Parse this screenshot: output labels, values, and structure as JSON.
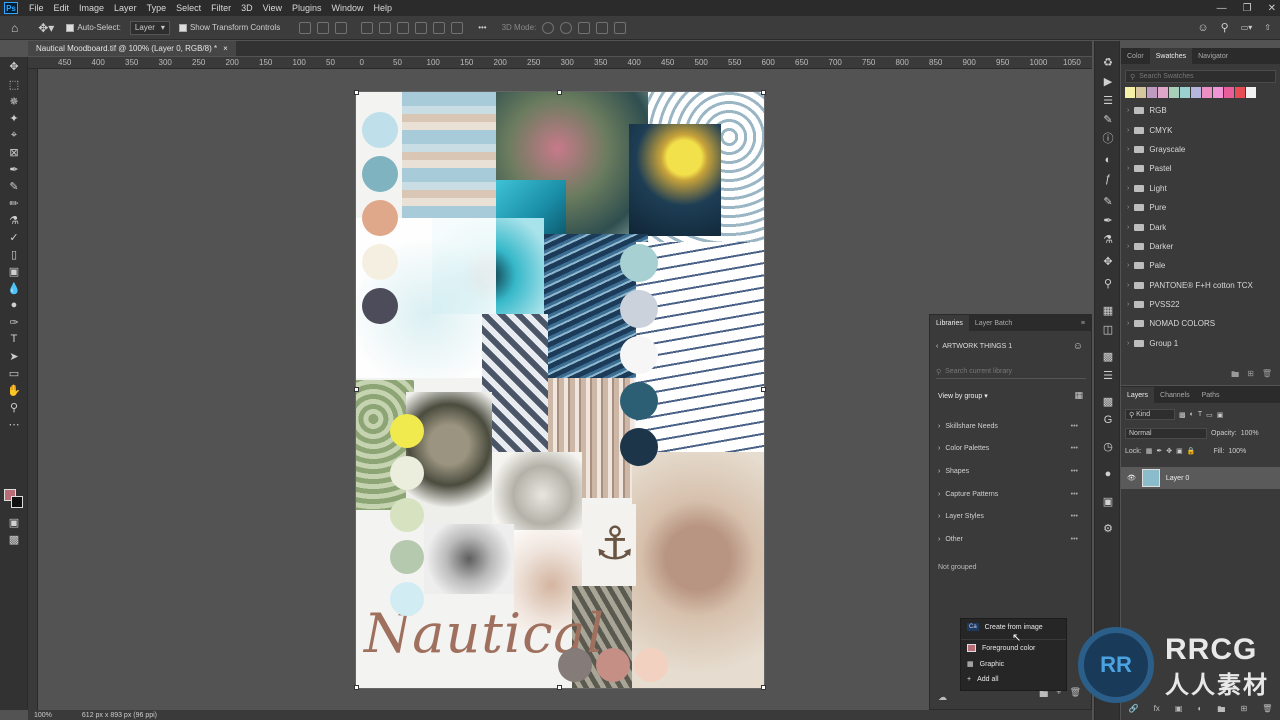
{
  "menubar": {
    "logo": "Ps",
    "items": [
      "File",
      "Edit",
      "Image",
      "Layer",
      "Type",
      "Select",
      "Filter",
      "3D",
      "View",
      "Plugins",
      "Window",
      "Help"
    ]
  },
  "options_bar": {
    "auto_select_label": "Auto-Select:",
    "auto_select_value": "Layer",
    "transform_label": "Show Transform Controls",
    "mode_3d_label": "3D Mode:"
  },
  "document": {
    "tab_title": "Nautical Moodboard.tif @ 100% (Layer 0, RGB/8) *",
    "headline": "Nautical"
  },
  "ruler": {
    "ticks": [
      "450",
      "400",
      "350",
      "300",
      "250",
      "200",
      "150",
      "100",
      "50",
      "0",
      "50",
      "100",
      "150",
      "200",
      "250",
      "300",
      "350",
      "400",
      "450",
      "500",
      "550",
      "600",
      "650",
      "700",
      "750",
      "800",
      "850",
      "900",
      "950",
      "1000",
      "1050"
    ]
  },
  "status_bar": {
    "zoom": "100%",
    "doc_info": "612 px x 893 px (96 ppi)"
  },
  "swatches_panel": {
    "tabs": [
      "Color",
      "Swatches",
      "Navigator"
    ],
    "active_tab": "Swatches",
    "search_placeholder": "Search Swatches",
    "recent_colors": [
      "#f6f0a8",
      "#d7c7a0",
      "#bf9bc1",
      "#e1a7c8",
      "#a9cfb8",
      "#9ccfd2",
      "#b5b5de",
      "#eb8fc5",
      "#f095d6",
      "#e85e9b",
      "#e64d54",
      "#f1f1f1"
    ],
    "groups": [
      "RGB",
      "CMYK",
      "Grayscale",
      "Pastel",
      "Light",
      "Pure",
      "Dark",
      "Darker",
      "Pale",
      "PANTONE® F+H cotton TCX",
      "PVSS22",
      "NOMAD COLORS",
      "Group 1"
    ]
  },
  "layers_panel": {
    "tabs": [
      "Layers",
      "Channels",
      "Paths"
    ],
    "active_tab": "Layers",
    "kind_label": "Kind",
    "blend_mode": "Normal",
    "opacity_label": "Opacity:",
    "opacity_value": "100%",
    "lock_label": "Lock:",
    "fill_label": "Fill:",
    "fill_value": "100%",
    "layer_name": "Layer 0"
  },
  "libraries_panel": {
    "tabs": [
      "Libraries",
      "Layer Batch"
    ],
    "active_tab": "Libraries",
    "library_name": "ARTWORK THINGS 1",
    "search_placeholder": "Search current library",
    "view_by": "View by group",
    "groups": [
      "Skillshare Needs",
      "Color Palettes",
      "Shapes",
      "Capture Patterns",
      "Layer Styles",
      "Other"
    ],
    "not_grouped": "Not grouped",
    "menu": {
      "create_from_image": "Create from image",
      "foreground_color": "Foreground color",
      "graphic": "Graphic",
      "add_all": "Add all"
    }
  },
  "palette": {
    "left_column": [
      "#bfe0ea",
      "#7fb3bf",
      "#e0a88a",
      "#f5efe1",
      "#4c4c5a"
    ],
    "middle_column": [
      "#a7d0d2",
      "#ccd2dc",
      "#f6f6f6",
      "#2d5f74",
      "#1c3548"
    ],
    "green_column": [
      "#f1ea4e",
      "#eceedd",
      "#d6e2c0",
      "#b5c9ae",
      "#d2ecf4"
    ],
    "bottom_row": [
      "#857b78",
      "#c58f85",
      "#f2d1c1"
    ]
  },
  "watermark": {
    "logo": "RR",
    "text1": "RRCG",
    "text2": "人人素材"
  }
}
